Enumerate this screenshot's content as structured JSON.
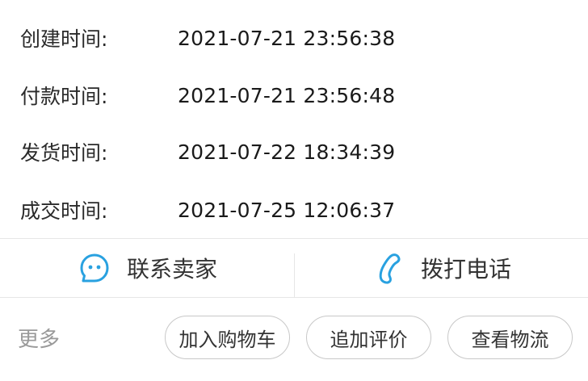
{
  "order_times": [
    {
      "label": "创建时间:",
      "value": "2021-07-21 23:56:38"
    },
    {
      "label": "付款时间:",
      "value": "2021-07-21 23:56:48"
    },
    {
      "label": "发货时间:",
      "value": "2021-07-22 18:34:39"
    },
    {
      "label": "成交时间:",
      "value": "2021-07-25 12:06:37"
    }
  ],
  "contact": {
    "seller_label": "联系卖家",
    "seller_icon": "chat-bubble-icon",
    "phone_label": "拨打电话",
    "phone_icon": "phone-icon",
    "icon_color": "#29a1e0"
  },
  "actions": {
    "more_label": "更多",
    "add_to_cart_label": "加入购物车",
    "add_review_label": "追加评价",
    "view_logistics_label": "查看物流"
  }
}
